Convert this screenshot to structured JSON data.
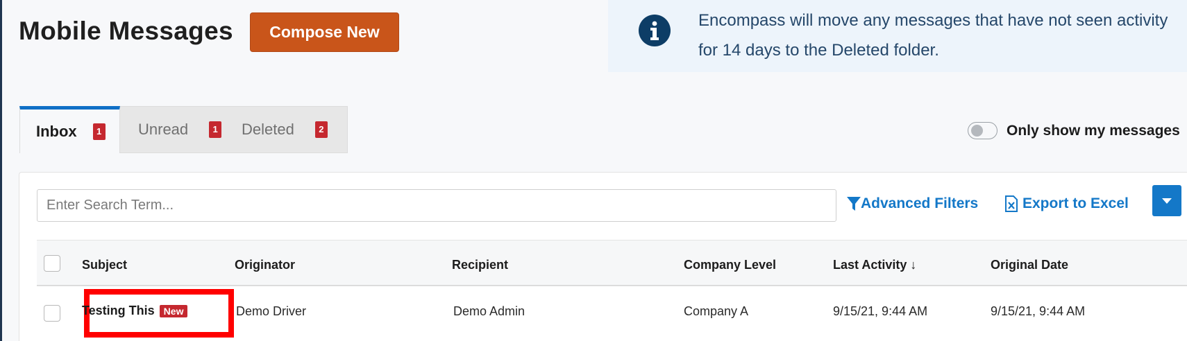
{
  "header": {
    "title": "Mobile Messages",
    "compose_label": "Compose New"
  },
  "info_banner": {
    "icon": "info-icon",
    "text": "Encompass will move any messages that have not seen activity for 14 days to the Deleted folder."
  },
  "tabs": [
    {
      "label": "Inbox",
      "count": "1",
      "active": true
    },
    {
      "label": "Unread",
      "count": "1",
      "active": false
    },
    {
      "label": "Deleted",
      "count": "2",
      "active": false
    }
  ],
  "toggle": {
    "label": "Only show my messages",
    "on": false
  },
  "toolbar": {
    "search_placeholder": "Enter Search Term...",
    "advanced_filters_label": "Advanced Filters",
    "export_label": "Export to Excel"
  },
  "table": {
    "columns": [
      "Subject",
      "Originator",
      "Recipient",
      "Company Level",
      "Last Activity ↓",
      "Original Date"
    ],
    "rows": [
      {
        "subject": "Testing This",
        "badge": "New",
        "originator": "Demo Driver",
        "recipient": "Demo Admin",
        "company_level": "Company A",
        "last_activity": "9/15/21, 9:44 AM",
        "original_date": "9/15/21, 9:44 AM"
      }
    ]
  },
  "colors": {
    "accent": "#1478c8",
    "compose": "#c9551a",
    "badge": "#c5282f",
    "highlight": "#ff0000"
  }
}
